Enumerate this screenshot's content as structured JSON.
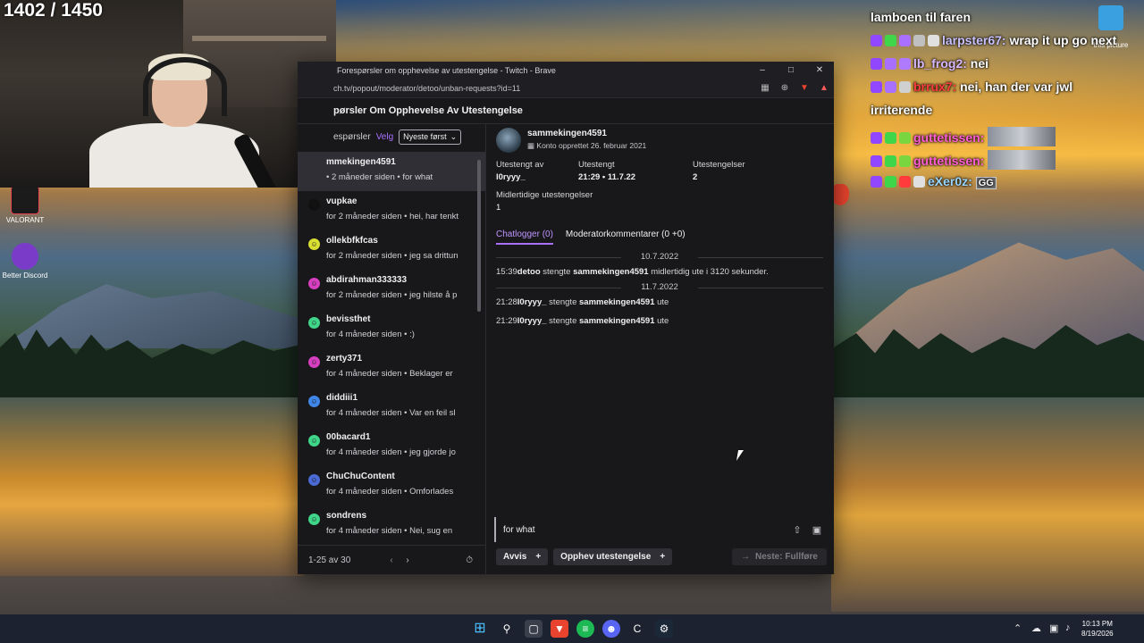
{
  "stream": {
    "counter": "1402 / 1450"
  },
  "desktop": {
    "icons": [
      {
        "label": "VALORANT",
        "color": "#e8434f"
      },
      {
        "label": "Better Discord",
        "color": "#7a3cc8"
      }
    ],
    "right_icon_label": "this picture"
  },
  "browser": {
    "title": "Forespørsler om opphevelse av utestengelse - Twitch - Brave",
    "url": "ch.tv/popout/moderator/detoo/unban-requests?id=11"
  },
  "page": {
    "heading": "pørsler Om Opphevelse Av Utestengelse",
    "list_header": {
      "label": "espørsler",
      "velg": "Velg",
      "sort": "Nyeste først"
    },
    "requests": [
      {
        "name": "mmekingen4591",
        "meta": "• 2 måneder siden • for what",
        "color": "#ffffff"
      },
      {
        "name": "vupkae",
        "meta": "for 2 måneder siden • hei, har tenkt",
        "color": "#111111"
      },
      {
        "name": "ollekbfkfcas",
        "meta": "for 2 måneder siden • jeg sa drittun",
        "color": "#d9e032"
      },
      {
        "name": "abdirahman333333",
        "meta": "for 2 måneder siden • jeg hilste å p",
        "color": "#d63fc0"
      },
      {
        "name": "bevissthet",
        "meta": "for 4 måneder siden • :)",
        "color": "#3fd68a"
      },
      {
        "name": "zerty371",
        "meta": "for 4 måneder siden • Beklager er",
        "color": "#d63fc0"
      },
      {
        "name": "diddiii1",
        "meta": "for 4 måneder siden • Var en feil sl",
        "color": "#3f86e8"
      },
      {
        "name": "00bacard1",
        "meta": "for 4 måneder siden • jeg gjorde jo",
        "color": "#3fd68a"
      },
      {
        "name": "ChuChuContent",
        "meta": "for 4 måneder siden • Omforlades",
        "color": "#4a6ad6"
      },
      {
        "name": "sondrens",
        "meta": "for 4 måneder siden • Nei, sug en",
        "color": "#3fd68a"
      }
    ],
    "pagination": "1-25 av 30",
    "detail": {
      "username": "sammekingen4591",
      "created": "Konto opprettet 26. februar 2021",
      "banned_by_label": "Utestengt av",
      "banned_by": "l0ryyy_",
      "banned_label": "Utestengt",
      "banned_at": "21:29 • 11.7.22",
      "bans_label": "Utestengelser",
      "bans": "2",
      "temp_label": "Midlertidige utestengelser",
      "temp": "1",
      "tab_chatlogs": "Chatlogger (0)",
      "tab_modcomments": "Moderatorkommentarer (0 +0)",
      "date1": "10.7.2022",
      "log1": {
        "time": "15:39",
        "actor": "detoo",
        "verb": " stengte ",
        "target": "sammekingen4591",
        "rest": " midlertidig ute i 3120 sekunder."
      },
      "date2": "11.7.2022",
      "log2": {
        "time": "21:28",
        "actor": "l0ryyy_",
        "verb": " stengte ",
        "target": "sammekingen4591",
        "rest": " ute"
      },
      "log3": {
        "time": "21:29",
        "actor": "l0ryyy_",
        "verb": " stengte ",
        "target": "sammekingen4591",
        "rest": " ute"
      },
      "reply": "for what",
      "deny": "Avvis",
      "unban": "Opphev utestengelse",
      "next": "Neste: Fullføre"
    }
  },
  "chat": {
    "lines": [
      {
        "user": "",
        "text": "lamboen til faren"
      },
      {
        "user": "larpster67:",
        "text": " wrap it up go next"
      },
      {
        "user": "lb_frog2:",
        "text": " nei"
      },
      {
        "user": "brrux7:",
        "text": " nei, han der var jwl"
      },
      {
        "user": "",
        "text": "irriterende"
      },
      {
        "user": "guttetissen:",
        "text": ""
      },
      {
        "user": "guttetissen:",
        "text": ""
      },
      {
        "user": "eXer0z:",
        "text": "GG"
      }
    ],
    "colors": {
      "larpster": "#c9c2ff",
      "frog": "#d8b8ff",
      "brrux": "#ff3b3b",
      "gutte": "#ff5cd6",
      "exer": "#9ad6ff"
    }
  },
  "taskbar": {
    "time": "10:13 PM",
    "date": "8/19/2026"
  }
}
